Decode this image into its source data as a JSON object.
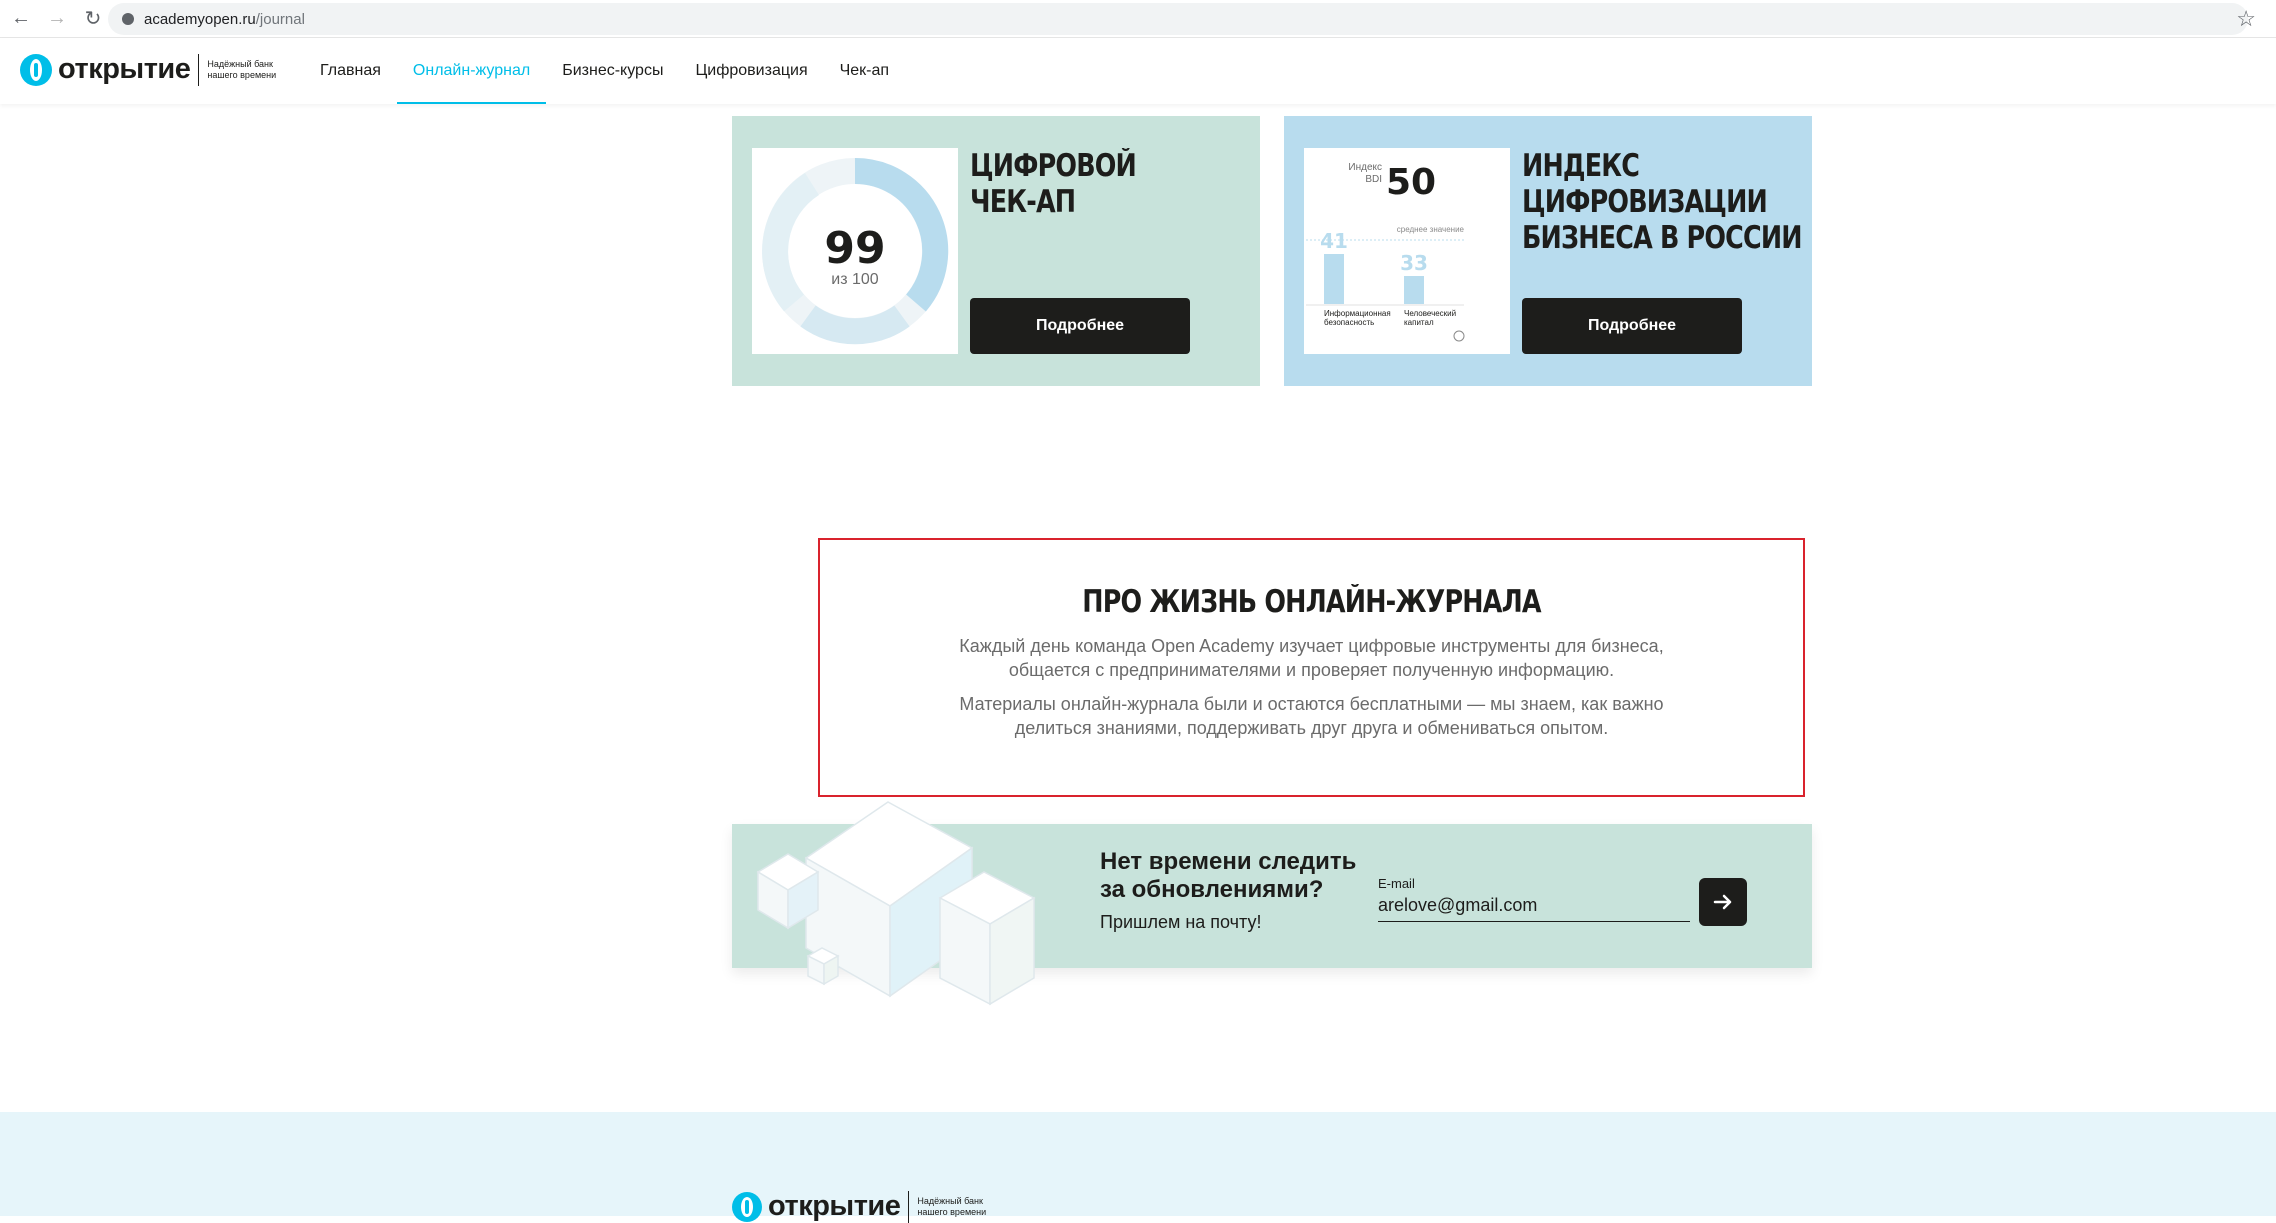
{
  "browser": {
    "url_domain": "academyopen.ru",
    "url_path": "/journal"
  },
  "header": {
    "logo_word": "открытие",
    "logo_tagline": "Надёжный банк нашего времени",
    "menu": [
      {
        "label": "Главная",
        "active": false
      },
      {
        "label": "Онлайн-журнал",
        "active": true
      },
      {
        "label": "Бизнес-курсы",
        "active": false
      },
      {
        "label": "Цифровизация",
        "active": false
      },
      {
        "label": "Чек-ап",
        "active": false
      }
    ]
  },
  "cards": {
    "checkup": {
      "title_line1": "ЦИФРОВОЙ",
      "title_line2": "ЧЕК-АП",
      "score": "99",
      "score_of": "из 100",
      "button": "Подробнее"
    },
    "index": {
      "title_line1": "ИНДЕКС",
      "title_line2": "ЦИФРОВИЗАЦИИ",
      "title_line3": "БИЗНЕСА В РОССИИ",
      "bdi_label_1": "Индекс",
      "bdi_label_2": "BDI",
      "bdi_value": "50",
      "avg_label": "среднее значение",
      "bar1_value": "41",
      "bar1_label_1": "Информационная",
      "bar1_label_2": "безопасность",
      "bar2_value": "33",
      "bar2_label_1": "Человеческий",
      "bar2_label_2": "капитал",
      "button": "Подробнее"
    }
  },
  "about": {
    "title": "ПРО ЖИЗНЬ ОНЛАЙН-ЖУРНАЛА",
    "paragraph1": "Каждый день команда Open Academy изучает цифровые инструменты для бизнеса, общается с предпринимателями и проверяет полученную информацию.",
    "paragraph2": "Материалы онлайн-журнала были и остаются бесплатными — мы знаем, как важно делиться знаниями, поддерживать друг друга и обмениваться опытом."
  },
  "subscribe": {
    "title": "Нет времени следить за обновлениями?",
    "text": "Пришлем на почту!",
    "email_label": "E-mail",
    "email_value": "arelove@gmail.com",
    "submit_icon": "arrow-right-icon"
  },
  "footer": {
    "logo_word": "открытие",
    "logo_tagline": "Надёжный банк нашего времени"
  },
  "colors": {
    "brand": "#00bee8",
    "green_card": "#c8e3db",
    "blue_card": "#b8dcee",
    "highlight_border": "#d9232d",
    "dark": "#1d1d1b"
  }
}
